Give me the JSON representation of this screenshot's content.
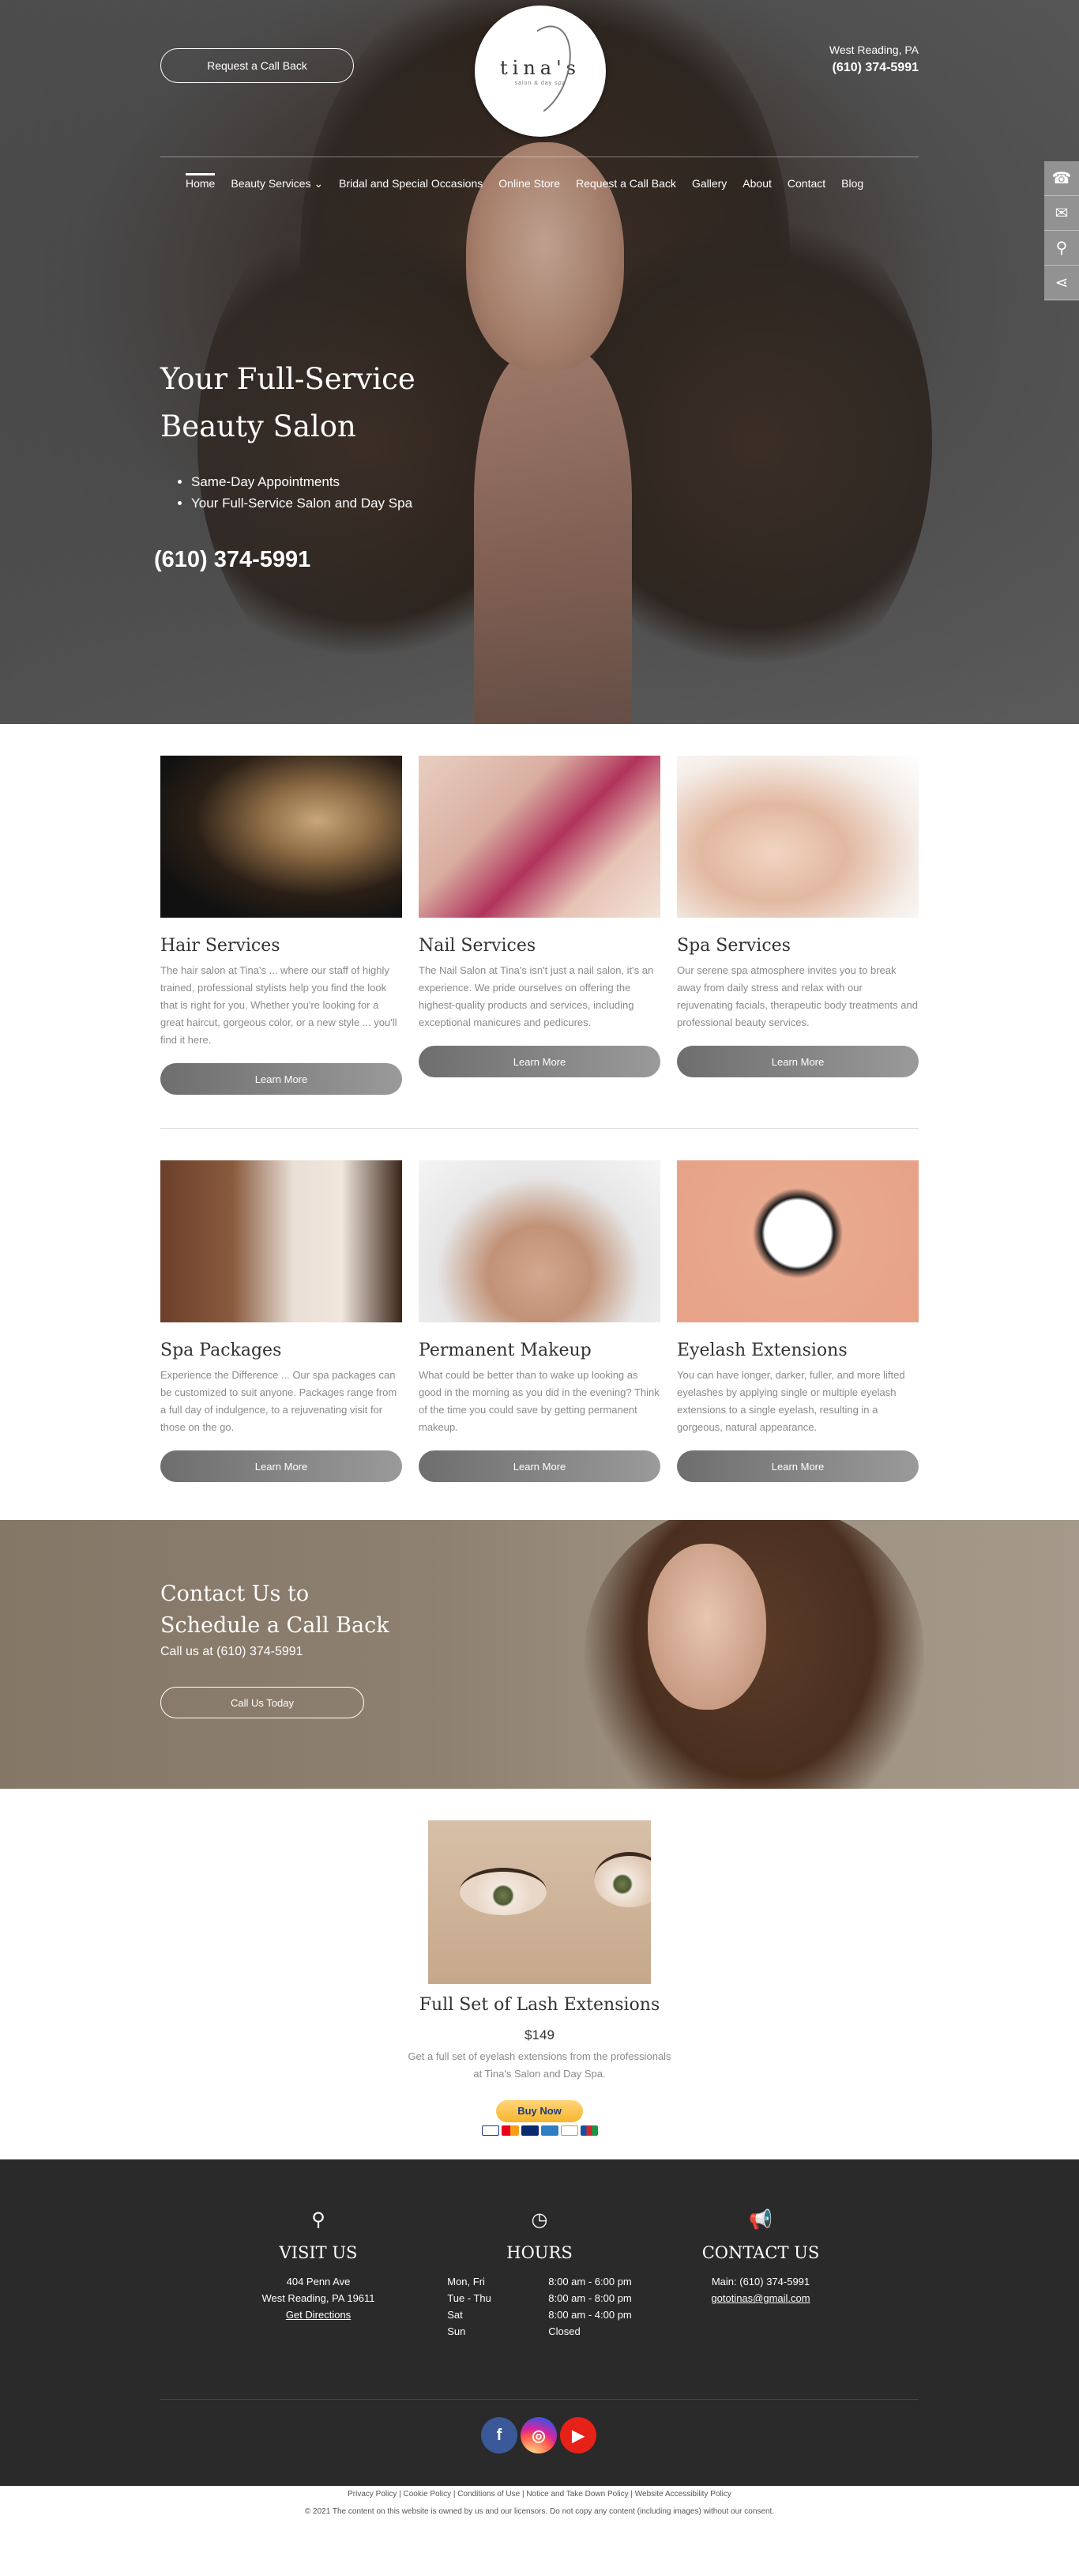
{
  "header": {
    "callback_button": "Request a Call Back",
    "logo_name": "tina's",
    "logo_sub": "salon & day spa",
    "location": "West Reading, PA",
    "phone": "(610) 374-5991"
  },
  "nav": [
    {
      "label": "Home"
    },
    {
      "label": "Beauty Services"
    },
    {
      "label": "Bridal and Special Occasions"
    },
    {
      "label": "Online Store"
    },
    {
      "label": "Request a Call Back"
    },
    {
      "label": "Gallery"
    },
    {
      "label": "About"
    },
    {
      "label": "Contact"
    },
    {
      "label": "Blog"
    }
  ],
  "hero": {
    "title_line1": "Your Full-Service",
    "title_line2": "Beauty Salon",
    "bullets": [
      "Same-Day Appointments",
      "Your Full-Service Salon and Day Spa"
    ],
    "phone": "(610) 374-5991"
  },
  "services": [
    {
      "title": "Hair Services",
      "text": "The hair salon at Tina's  ... where our staff of highly trained, professional stylists help you find the look that is right for you.  Whether you're looking for a great haircut, gorgeous color, or a new style ... you'll find it here.",
      "button": "Learn More"
    },
    {
      "title": "Nail Services",
      "text": "The Nail Salon at Tina's isn't just a nail salon, it's an experience.  We pride ourselves on offering the highest-quality products and services, including exceptional manicures and pedicures.",
      "button": "Learn More"
    },
    {
      "title": "Spa Services",
      "text": "Our serene spa atmosphere invites you to break away from daily stress and relax with our rejuvenating facials, therapeutic body treatments and professional beauty services.",
      "button": "Learn More"
    },
    {
      "title": "Spa Packages",
      "text": "Experience the Difference ... Our spa packages can be customized to suit anyone.  Packages range from a full day of indulgence, to a rejuvenating visit for those on the go.",
      "button": "Learn More"
    },
    {
      "title": "Permanent Makeup",
      "text": " What could be better than to wake up looking as good in the morning as you did in the evening? Think of the time you could save by getting permanent makeup.",
      "button": "Learn More"
    },
    {
      "title": "Eyelash Extensions",
      "text": "You can have longer, darker, fuller, and more lifted eyelashes by applying single or multiple eyelash extensions to a single eyelash, resulting in a gorgeous, natural appearance.",
      "button": "Learn More"
    }
  ],
  "contact_band": {
    "title_line1": "Contact Us to",
    "title_line2": "Schedule a Call Back",
    "subtitle": "Call us at (610) 374-5991",
    "button": "Call Us Today"
  },
  "product": {
    "title": "Full Set of Lash Extensions",
    "price": "$149",
    "desc_line1": "Get a full set of eyelash extensions from the professionals",
    "desc_line2": "at Tina's Salon and Day Spa.",
    "buy_label": "Buy Now"
  },
  "footer": {
    "visit": {
      "title": "VISIT US",
      "address1": "404 Penn Ave",
      "address2": "West Reading, PA 19611",
      "link": "Get Directions"
    },
    "hours": {
      "title": "HOURS",
      "rows": [
        {
          "day": "Mon, Fri",
          "time": "8:00 am - 6:00 pm"
        },
        {
          "day": "Tue - Thu",
          "time": "8:00 am - 8:00 pm"
        },
        {
          "day": "Sat",
          "time": "8:00 am - 4:00 pm"
        },
        {
          "day": "Sun",
          "time": "Closed"
        }
      ]
    },
    "contact": {
      "title": "CONTACT US",
      "main": "Main: (610) 374-5991",
      "email": "gototinas@gmail.com"
    },
    "links": "Privacy Policy | Cookie Policy | Conditions of Use | Notice and Take Down Policy | Website Accessibility Policy",
    "copyright": "© 2021 The content on this website is owned by us and our licensors. Do not copy any content (including images) without our consent."
  },
  "colors": {
    "footer_bg": "#2a2a2a",
    "button_gray": "#7a7a7a",
    "facebook": "#3b5998",
    "instagram": "#c13584",
    "youtube": "#e62117"
  },
  "icons": [
    "phone-icon",
    "mail-icon",
    "location-pin-icon",
    "share-icon",
    "clock-icon",
    "megaphone-icon",
    "facebook-icon",
    "instagram-icon",
    "youtube-icon"
  ]
}
